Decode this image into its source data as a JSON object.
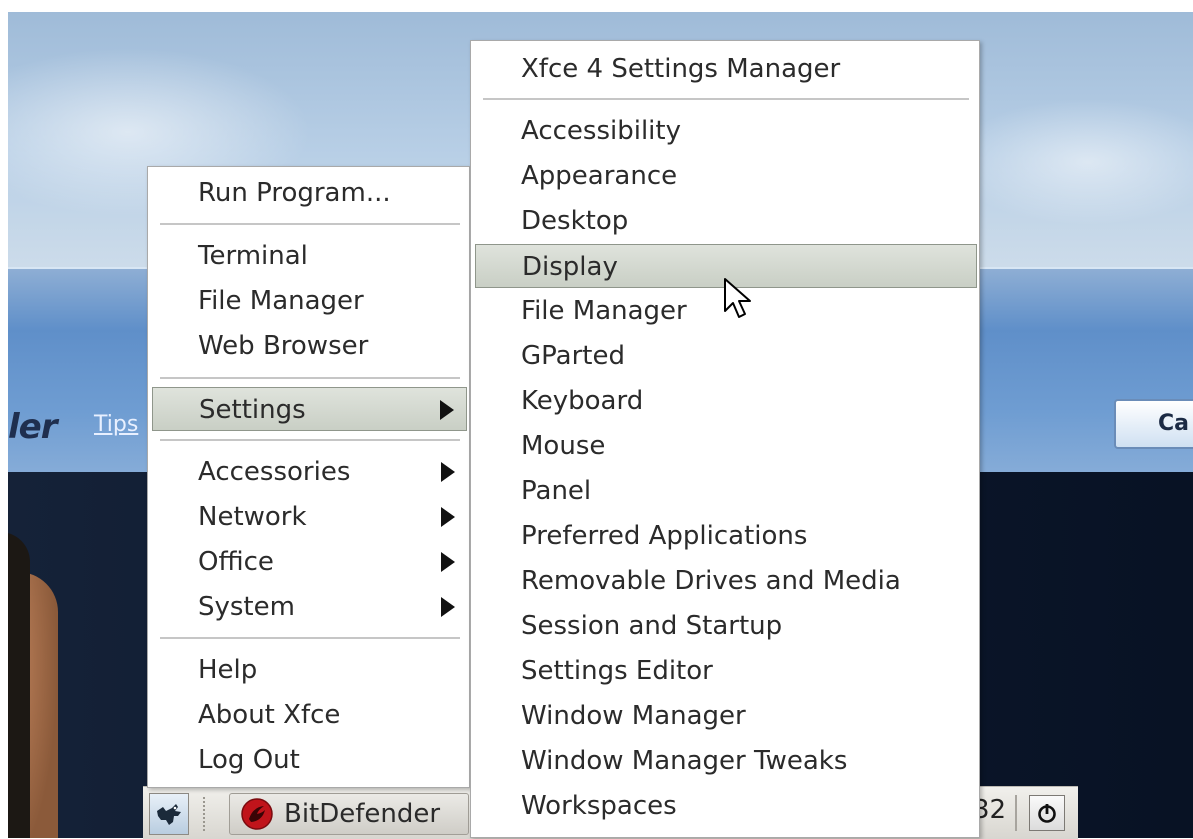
{
  "background": {
    "logo_fragment": "ler",
    "tips_link": "Tips",
    "cancel_fragment": "Ca"
  },
  "main_menu": {
    "run_program": "Run Program...",
    "terminal": "Terminal",
    "file_manager": "File Manager",
    "web_browser": "Web Browser",
    "settings": "Settings",
    "accessories": "Accessories",
    "network": "Network",
    "office": "Office",
    "system": "System",
    "help": "Help",
    "about": "About Xfce",
    "log_out": "Log Out"
  },
  "settings_menu": {
    "settings_manager": "Xfce 4 Settings Manager",
    "items": [
      "Accessibility",
      "Appearance",
      "Desktop",
      "Display",
      "File Manager",
      "GParted",
      "Keyboard",
      "Mouse",
      "Panel",
      "Preferred Applications",
      "Removable Drives and Media",
      "Session and Startup",
      "Settings Editor",
      "Window Manager",
      "Window Manager Tweaks",
      "Workspaces"
    ],
    "highlighted": "Display"
  },
  "taskbar": {
    "task_label": "BitDefender",
    "clock_fragment": "32"
  },
  "colors": {
    "highlight": "#c9cfc5",
    "menu_bg": "#ffffff",
    "sky": "#b8cfe6",
    "band": "#6f9dd2"
  }
}
